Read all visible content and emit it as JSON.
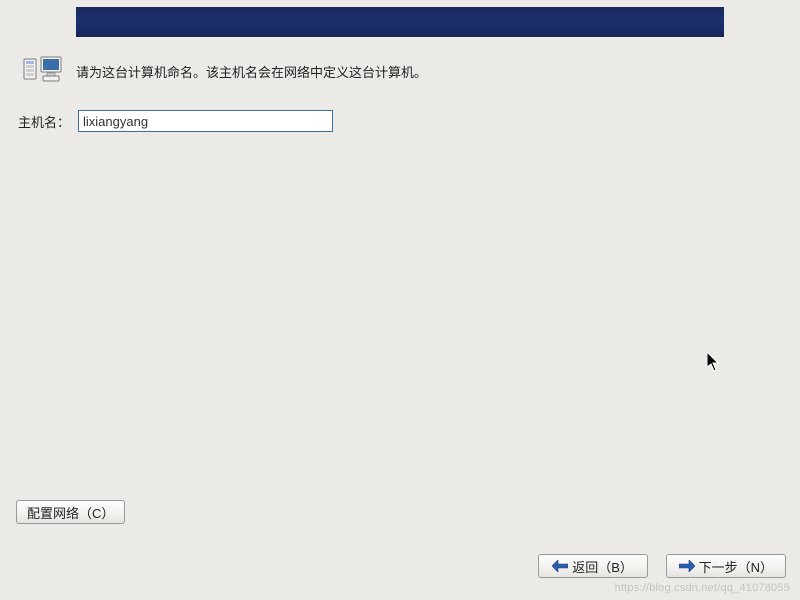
{
  "colors": {
    "banner": "#1c2f6e",
    "button_bg": "#f2f1ee",
    "arrow_blue": "#2a5db0"
  },
  "icons": {
    "computers": "computers-icon",
    "back_arrow": "arrow-left-icon",
    "next_arrow": "arrow-right-icon"
  },
  "instruction": "请为这台计算机命名。该主机名会在网络中定义这台计算机。",
  "hostname": {
    "label": "主机名：",
    "value": "lixiangyang",
    "placeholder": ""
  },
  "buttons": {
    "configure_network": "配置网络（C）",
    "back": "返回（B）",
    "next": "下一步（N）"
  },
  "watermark": "https://blog.csdn.net/qq_41078055"
}
